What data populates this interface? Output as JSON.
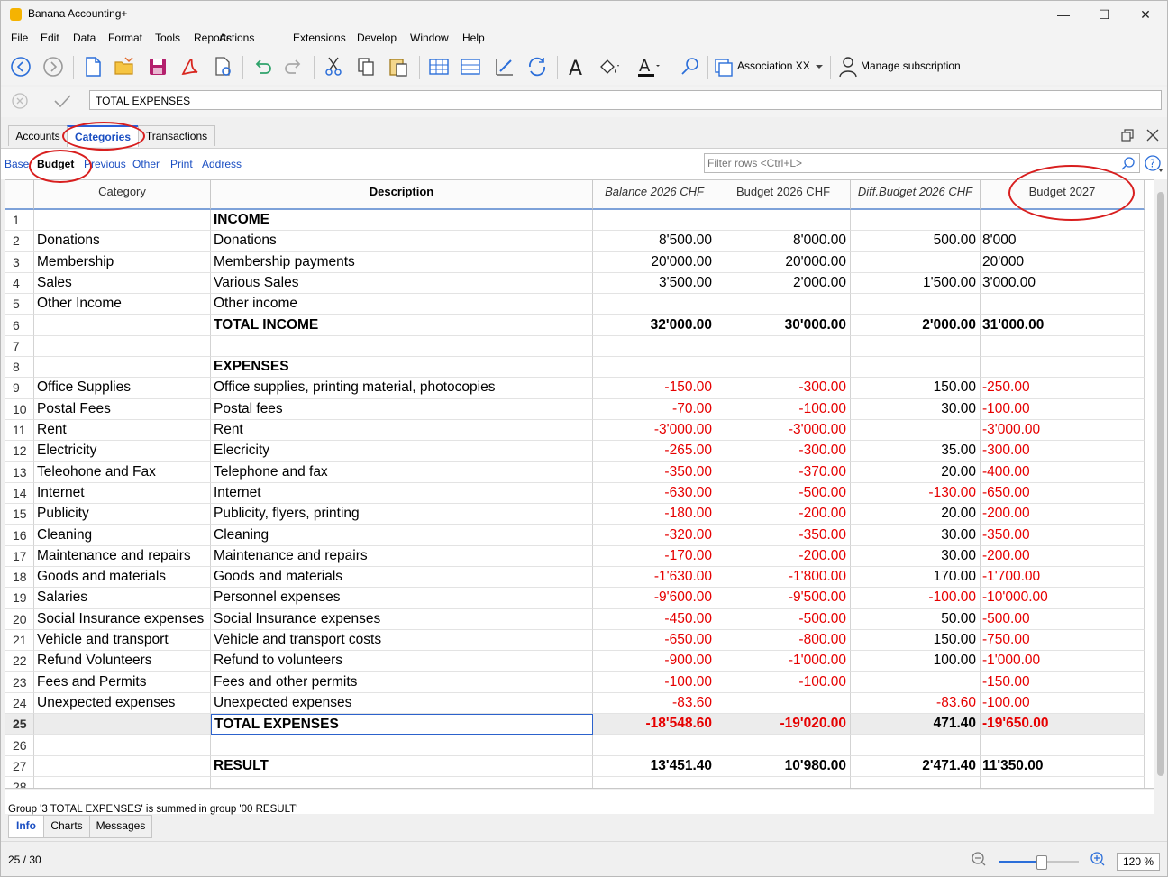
{
  "window": {
    "title": "Banana Accounting+",
    "minimize": "—",
    "maximize": "☐",
    "close": "✕"
  },
  "menu": [
    "File",
    "Edit",
    "Data",
    "Format",
    "Tools",
    "Reports",
    "Actions",
    "Extensions",
    "Develop",
    "Window",
    "Help"
  ],
  "menu_accel": [
    "F",
    "E",
    "D",
    "m",
    "T",
    "R",
    "A",
    "E",
    "v",
    "W",
    "H"
  ],
  "toolbar": {
    "file_label": "Association XX",
    "subscription_label": "Manage subscription"
  },
  "formula": {
    "value": "TOTAL EXPENSES"
  },
  "tabs": [
    "Accounts",
    "Categories",
    "Transactions"
  ],
  "active_tab": "Categories",
  "views": [
    "Base",
    "Budget",
    "Previous",
    "Other",
    "Print",
    "Address"
  ],
  "active_view": "Budget",
  "filter": {
    "placeholder": "Filter rows <Ctrl+L>"
  },
  "columns": [
    "Category",
    "Description",
    "Balance 2026 CHF",
    "Budget 2026 CHF",
    "Diff.Budget 2026 CHF",
    "Budget 2027"
  ],
  "rows": [
    {
      "n": "1",
      "cat": "",
      "desc": "INCOME",
      "bal": "",
      "bud": "",
      "diff": "",
      "b27": "",
      "bold": true
    },
    {
      "n": "2",
      "cat": "Donations",
      "desc": "Donations",
      "bal": "8'500.00",
      "bud": "8'000.00",
      "diff": "500.00",
      "b27": "8'000"
    },
    {
      "n": "3",
      "cat": "Membership",
      "desc": "Membership payments",
      "bal": "20'000.00",
      "bud": "20'000.00",
      "diff": "",
      "b27": "20'000"
    },
    {
      "n": "4",
      "cat": "Sales",
      "desc": "Various Sales",
      "bal": "3'500.00",
      "bud": "2'000.00",
      "diff": "1'500.00",
      "b27": "3'000.00"
    },
    {
      "n": "5",
      "cat": "Other Income",
      "desc": "Other income",
      "bal": "",
      "bud": "",
      "diff": "",
      "b27": ""
    },
    {
      "n": "6",
      "cat": "",
      "desc": "TOTAL INCOME",
      "bal": "32'000.00",
      "bud": "30'000.00",
      "diff": "2'000.00",
      "b27": "31'000.00",
      "bold": true
    },
    {
      "n": "7",
      "cat": "",
      "desc": "",
      "bal": "",
      "bud": "",
      "diff": "",
      "b27": ""
    },
    {
      "n": "8",
      "cat": "",
      "desc": "EXPENSES",
      "bal": "",
      "bud": "",
      "diff": "",
      "b27": "",
      "bold": true
    },
    {
      "n": "9",
      "cat": "Office Supplies",
      "desc": "Office supplies, printing material, photocopies",
      "bal": "-150.00",
      "bud": "-300.00",
      "diff": "150.00",
      "b27": "-250.00"
    },
    {
      "n": "10",
      "cat": "Postal Fees",
      "desc": "Postal fees",
      "bal": "-70.00",
      "bud": "-100.00",
      "diff": "30.00",
      "b27": "-100.00"
    },
    {
      "n": "11",
      "cat": "Rent",
      "desc": "Rent",
      "bal": "-3'000.00",
      "bud": "-3'000.00",
      "diff": "",
      "b27": "-3'000.00"
    },
    {
      "n": "12",
      "cat": "Electricity",
      "desc": "Elecricity",
      "bal": "-265.00",
      "bud": "-300.00",
      "diff": "35.00",
      "b27": "-300.00"
    },
    {
      "n": "13",
      "cat": "Teleohone and Fax",
      "desc": "Telephone and fax",
      "bal": "-350.00",
      "bud": "-370.00",
      "diff": "20.00",
      "b27": "-400.00"
    },
    {
      "n": "14",
      "cat": "Internet",
      "desc": "Internet",
      "bal": "-630.00",
      "bud": "-500.00",
      "diff": "-130.00",
      "b27": "-650.00"
    },
    {
      "n": "15",
      "cat": "Publicity",
      "desc": "Publicity, flyers, printing",
      "bal": "-180.00",
      "bud": "-200.00",
      "diff": "20.00",
      "b27": "-200.00"
    },
    {
      "n": "16",
      "cat": "Cleaning",
      "desc": "Cleaning",
      "bal": "-320.00",
      "bud": "-350.00",
      "diff": "30.00",
      "b27": "-350.00"
    },
    {
      "n": "17",
      "cat": "Maintenance and repairs",
      "desc": "Maintenance and repairs",
      "bal": "-170.00",
      "bud": "-200.00",
      "diff": "30.00",
      "b27": "-200.00"
    },
    {
      "n": "18",
      "cat": "Goods and materials",
      "desc": "Goods and materials",
      "bal": "-1'630.00",
      "bud": "-1'800.00",
      "diff": "170.00",
      "b27": "-1'700.00"
    },
    {
      "n": "19",
      "cat": "Salaries",
      "desc": "Personnel expenses",
      "bal": "-9'600.00",
      "bud": "-9'500.00",
      "diff": "-100.00",
      "b27": "-10'000.00"
    },
    {
      "n": "20",
      "cat": "Social Insurance expenses",
      "desc": "Social Insurance expenses",
      "bal": "-450.00",
      "bud": "-500.00",
      "diff": "50.00",
      "b27": "-500.00"
    },
    {
      "n": "21",
      "cat": "Vehicle and transport",
      "desc": "Vehicle and transport costs",
      "bal": "-650.00",
      "bud": "-800.00",
      "diff": "150.00",
      "b27": "-750.00"
    },
    {
      "n": "22",
      "cat": "Refund Volunteers",
      "desc": "Refund to volunteers",
      "bal": "-900.00",
      "bud": "-1'000.00",
      "diff": "100.00",
      "b27": "-1'000.00"
    },
    {
      "n": "23",
      "cat": "Fees and Permits",
      "desc": "Fees and other permits",
      "bal": "-100.00",
      "bud": "-100.00",
      "diff": "",
      "b27": "-150.00"
    },
    {
      "n": "24",
      "cat": "Unexpected expenses",
      "desc": "Unexpected expenses",
      "bal": "-83.60",
      "bud": "",
      "diff": "-83.60",
      "b27": "-100.00"
    },
    {
      "n": "25",
      "cat": "",
      "desc": "TOTAL EXPENSES",
      "bal": "-18'548.60",
      "bud": "-19'020.00",
      "diff": "471.40",
      "b27": "-19'650.00",
      "bold": true,
      "selected": true
    },
    {
      "n": "26",
      "cat": "",
      "desc": "",
      "bal": "",
      "bud": "",
      "diff": "",
      "b27": ""
    },
    {
      "n": "27",
      "cat": "",
      "desc": "RESULT",
      "bal": "13'451.40",
      "bud": "10'980.00",
      "diff": "2'471.40",
      "b27": "11'350.00",
      "bold": true
    },
    {
      "n": "28",
      "cat": "",
      "desc": "",
      "bal": "",
      "bud": "",
      "diff": "",
      "b27": ""
    }
  ],
  "info": {
    "message": "Group '3 TOTAL EXPENSES' is summed in group '00 RESULT'"
  },
  "bottom_tabs": [
    "Info",
    "Charts",
    "Messages"
  ],
  "status": {
    "position": "25 / 30",
    "zoom": "120 %",
    "zoom_level": 0.47
  },
  "colors": {
    "negative": "#e60000",
    "accent": "#1a4ec2",
    "annotation": "#d81e1e"
  }
}
